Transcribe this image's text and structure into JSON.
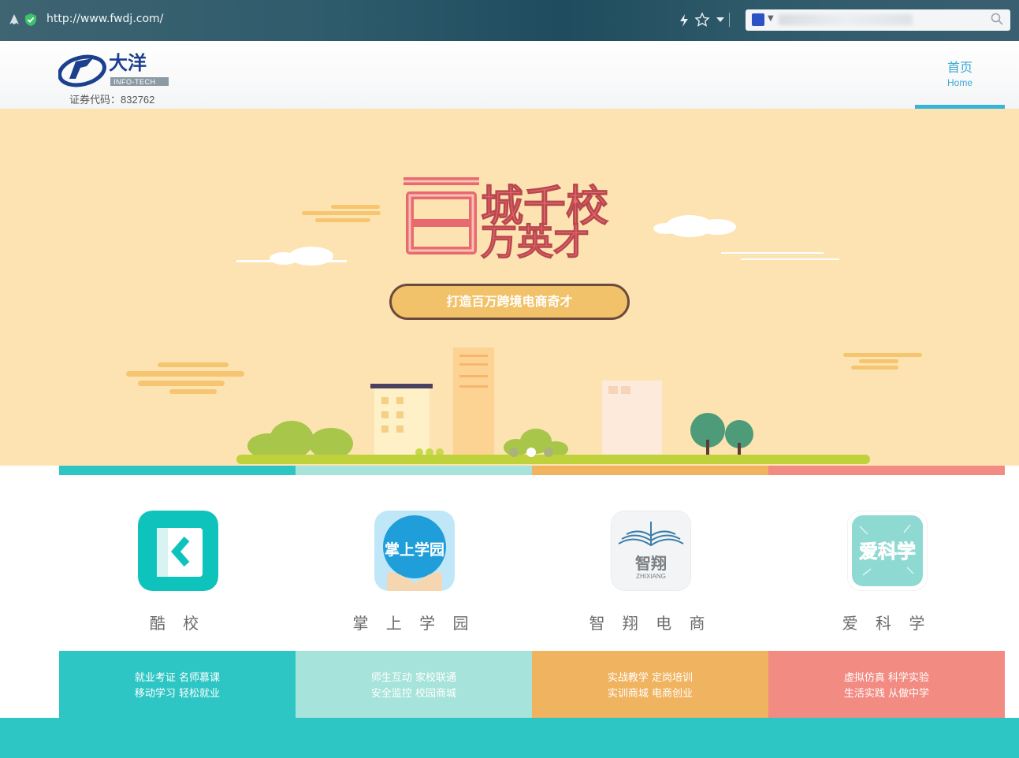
{
  "browser": {
    "url": "http://www.fwdj.com/",
    "search_placeholder": ""
  },
  "header": {
    "logo_text": "大洋",
    "logo_sub": "INFO-TECH",
    "stock_code": "证券代码：832762",
    "nav_home_zh": "首页",
    "nav_home_en": "Home"
  },
  "banner": {
    "headline": "百城千校 百万英才",
    "slogan": "打造百万跨境电商奇才",
    "carousel_dots": 3,
    "active_dot": 2
  },
  "apps": [
    {
      "name": "酷 校",
      "icon": "kuxiao-icon",
      "color": "#2ec6c4"
    },
    {
      "name": "掌 上 学 园",
      "icon": "zhangshang-xueyuan-icon",
      "icon_text": "掌上学园",
      "color": "#a6e3da"
    },
    {
      "name": "智 翔 电 商",
      "icon": "zhixiang-icon",
      "icon_text": "智翔",
      "icon_sub": "ZHIXIANG",
      "color": "#f0b35f"
    },
    {
      "name": "爱 科 学",
      "icon": "aikexue-icon",
      "icon_text": "爱科学",
      "color": "#f28b82"
    }
  ],
  "tiles": [
    {
      "line1": "就业考证  名师慕课",
      "line2": "移动学习  轻松就业"
    },
    {
      "line1": "师生互动  家校联通",
      "line2": "安全监控  校园商城"
    },
    {
      "line1": "实战教学  定岗培训",
      "line2": "实训商城  电商创业"
    },
    {
      "line1": "虚拟仿真  科学实验",
      "line2": "生活实践  从做中学"
    }
  ]
}
